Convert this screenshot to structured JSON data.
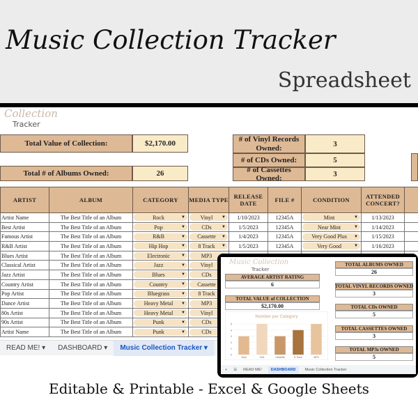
{
  "hero": {
    "title": "Music Collection Tracker",
    "subtitle": "Spreadsheet",
    "tagline": "Editable & Printable - Excel & Google Sheets"
  },
  "logo": {
    "script": "Collection",
    "text": "Tracker"
  },
  "summary": {
    "total_value_label": "Total Value of Collection:",
    "total_value": "$2,170.00",
    "albums_label": "Total # of Albums Owned:",
    "albums": "26",
    "vinyl_label": "# of Vinyl Records Owned:",
    "vinyl": "3",
    "cds_label": "# of CDs Owned:",
    "cds": "5",
    "cassettes_label": "# of Cassettes Owned:",
    "cassettes": "3"
  },
  "table": {
    "headers": [
      "ARTIST",
      "ALBUM",
      "CATEGORY",
      "MEDIA TYPE",
      "RELEASE DATE",
      "FILE #",
      "CONDITION",
      "ATTENDED CONCERT?"
    ],
    "rows": [
      [
        "Artist Name",
        "The Best Title of an Album",
        "Rock",
        "Vinyl",
        "1/10/2023",
        "12345A",
        "Mint",
        "1/13/2023"
      ],
      [
        "Best Artist",
        "The Best Title of an Album",
        "Pop",
        "CDs",
        "1/5/2023",
        "12345A",
        "Near Mint",
        "1/14/2023"
      ],
      [
        "Famous Artist",
        "The Best Title of an Album",
        "R&B",
        "Cassette",
        "1/4/2023",
        "12345A",
        "Very Good Plus",
        "1/15/2023"
      ],
      [
        "R&B Artist",
        "The Best Title of an Album",
        "Hip Hop",
        "8 Track",
        "1/5/2023",
        "12345A",
        "Very Good",
        "1/16/2023"
      ],
      [
        "Blues Artist",
        "The Best Title of an Album",
        "Electronic",
        "MP3",
        "",
        "",
        "",
        ""
      ],
      [
        "Classical Artist",
        "The Best Title of an Album",
        "Jazz",
        "Vinyl",
        "",
        "",
        "",
        ""
      ],
      [
        "Jazz Artist",
        "The Best Title of an Album",
        "Blues",
        "CDs",
        "",
        "",
        "",
        ""
      ],
      [
        "Country Artist",
        "The Best Title of an Album",
        "Country",
        "Cassette",
        "",
        "",
        "",
        ""
      ],
      [
        "Pop Artist",
        "The Best Title of an Album",
        "Bluegrass",
        "8 Track",
        "",
        "",
        "",
        ""
      ],
      [
        "Dance Artist",
        "The Best Title of an Album",
        "Heavy Metal",
        "MP3",
        "",
        "",
        "",
        ""
      ],
      [
        "80s Artist",
        "The Best Title of an Album",
        "Heavy Metal",
        "Vinyl",
        "",
        "",
        "",
        ""
      ],
      [
        "90s Artist",
        "The Best Title of an Album",
        "Punk",
        "CDs",
        "",
        "",
        "",
        ""
      ],
      [
        "Artist Name",
        "The Best Title of an Album",
        "Punk",
        "CDs",
        "",
        "",
        "",
        ""
      ]
    ]
  },
  "tabs": [
    "READ ME!",
    "DASHBOARD",
    "Music Collection Tracker"
  ],
  "tabs_active": 2,
  "dashboard": {
    "logo_script": "Music Collection",
    "logo_text": "Tracker",
    "avg_rating_label": "AVERAGE ARTIST RATING",
    "avg_rating": "6",
    "total_value_label": "TOTAL VALUE of COLLECTION",
    "total_value": "$2,170.00",
    "cards": [
      {
        "label": "TOTAL ALBUMS OWNED",
        "value": "26"
      },
      {
        "label": "TOTAL VINYL RECORDS OWNED",
        "value": "3"
      },
      {
        "label": "TOTAL CDs OWNED",
        "value": "5"
      },
      {
        "label": "TOTAL CASSETTES OWNED",
        "value": "3"
      },
      {
        "label": "TOTAL MP3s OWNED",
        "value": "5"
      }
    ],
    "tabs": [
      "READ ME!",
      "DASHBOARD",
      "Music Collection Tracker"
    ]
  },
  "chart_data": {
    "type": "bar",
    "title": "Number per Category",
    "categories": [
      "Vinyl",
      "CDs",
      "Cassette",
      "8 Track",
      "MP3"
    ],
    "values": [
      3,
      5,
      3,
      4,
      5
    ],
    "ylim": [
      0,
      5
    ],
    "yticks": [
      0,
      1,
      2,
      3,
      4,
      5
    ],
    "grid": true,
    "colors": [
      "#e3b98f",
      "#f1d7bd",
      "#c8976a",
      "#a8733f",
      "#e8c49e"
    ]
  }
}
